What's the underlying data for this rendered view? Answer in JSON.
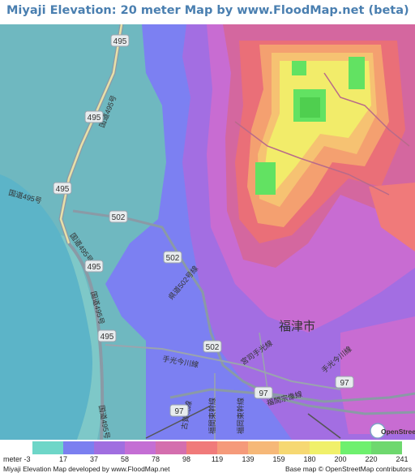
{
  "title": "Miyaji Elevation: 20 meter Map by www.FloodMap.net (beta)",
  "map": {
    "route_numbers": [
      "495",
      "495",
      "495",
      "495",
      "495",
      "502",
      "502",
      "502",
      "97",
      "97",
      "97"
    ],
    "road_names": [
      "国道495号",
      "国道495号",
      "国道495号",
      "国道495号",
      "国道495号",
      "県道502号線",
      "宮司手光線",
      "手光今川線",
      "手光今川線",
      "福岡東幹線",
      "福間東幹線",
      "福間宗像線",
      "古賀北線"
    ],
    "city_label": "福津市",
    "osm_logo_text": "OpenStreetMap"
  },
  "legend": {
    "colors": [
      "#6ed6c8",
      "#7b7ff0",
      "#a06ee0",
      "#c46ed4",
      "#d46eae",
      "#f07a7a",
      "#f59a7a",
      "#f6b878",
      "#f6d872",
      "#f0f06a",
      "#6ef06e",
      "#6ed86e"
    ],
    "labels": [
      "meter -3",
      "17",
      "37",
      "58",
      "78",
      "98",
      "119",
      "139",
      "159",
      "180",
      "200",
      "220",
      "241"
    ]
  },
  "footer": {
    "left": "Miyaji Elevation Map developed by www.FloodMap.net",
    "right": "Base map © OpenStreetMap contributors"
  }
}
